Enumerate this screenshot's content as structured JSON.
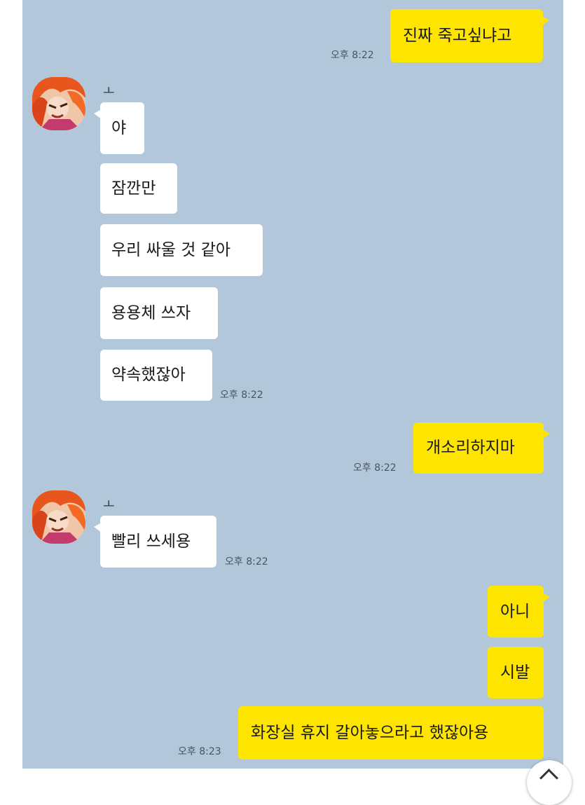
{
  "chat": {
    "background": "#b2c7d9",
    "my_bubble_color": "#fee500",
    "their_bubble_color": "#ffffff",
    "sender_name": "ㅗ",
    "messages": [
      {
        "from": "me",
        "text": "진짜 죽고싶냐고",
        "time": "오후 8:22"
      },
      {
        "from": "them",
        "text": "야"
      },
      {
        "from": "them",
        "text": "잠깐만"
      },
      {
        "from": "them",
        "text": "우리 싸울 것 같아"
      },
      {
        "from": "them",
        "text": "용용체 쓰자"
      },
      {
        "from": "them",
        "text": "약속했잖아",
        "time": "오후 8:22"
      },
      {
        "from": "me",
        "text": "개소리하지마",
        "time": "오후 8:22"
      },
      {
        "from": "them",
        "text": "빨리 쓰세용",
        "time": "오후 8:22"
      },
      {
        "from": "me",
        "text": "아니"
      },
      {
        "from": "me",
        "text": "시발"
      },
      {
        "from": "me",
        "text": "화장실 휴지 갈아놓으라고 했잖아용",
        "time": "오후 8:23"
      }
    ]
  },
  "scroll_button": {
    "icon": "chevron-up-icon"
  }
}
